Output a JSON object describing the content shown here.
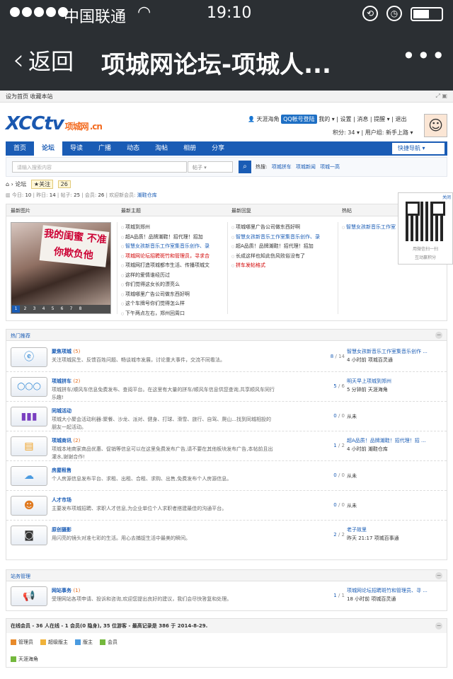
{
  "status": {
    "carrier": "中国联通",
    "time": "19:10"
  },
  "nav": {
    "back": "返回",
    "title": "项城网论坛-项城人...",
    "more": "•••"
  },
  "toplinks": {
    "home": "设为首页",
    "fav": "收藏本站"
  },
  "logo": {
    "main": "XCCtv",
    "sub": "项城网",
    "cn": ".cn"
  },
  "user": {
    "name": "天涯海角",
    "qq": "QQ帐号登陆",
    "links": "我的 ▾ | 设置 | 消息 | 提醒 ▾ | 退出",
    "score": "积分: 34 ▾",
    "group": "用户组: 新手上路 ▾"
  },
  "mainnav": {
    "items": [
      "首页",
      "论坛",
      "导读",
      "广播",
      "动态",
      "淘帖",
      "相册",
      "分享"
    ],
    "active": 1,
    "quick": "快捷导航 ▾"
  },
  "search": {
    "placeholder": "请输入搜索内容",
    "scope": "帖子 ▾",
    "hot_label": "热搜:",
    "hot": [
      "项城拼车",
      "项城新闻",
      "项城一高"
    ]
  },
  "crumb": {
    "text": "论坛",
    "fav": "关注",
    "fav_count": "26"
  },
  "stats": {
    "today_label": "今日:",
    "today": "10",
    "yday_label": "昨日:",
    "yday": "14",
    "posts_label": "帖子:",
    "posts": "25",
    "members_label": "会员:",
    "members": "26",
    "welcome": "欢迎新会员:",
    "newest": "潮鞋仓库"
  },
  "qr": {
    "close": "关闭",
    "line1": "用微信扫一扫",
    "line2": "互动赢积分"
  },
  "panel": {
    "head": [
      "最新图片",
      "最新主题",
      "最新回复",
      "热帖"
    ],
    "image_caption": "我的闺蜜 不准你欺负他",
    "pages": [
      "1",
      "2",
      "3",
      "4",
      "5",
      "6",
      "7",
      "8"
    ],
    "topics": [
      "项城到郑州",
      "超A品质！品牌潮鞋！招代理！招加",
      "智慧女孩新音乐工作室集音乐创作、录",
      "项城网论坛招聘斑竹和管理员，寻求合",
      "项城网打造项城都市生活、传播项城文",
      "这样的爱情谁经历过",
      "你们觉得这女长的漂亮么",
      "项城哪里广告公司做东西好啊",
      "这个车牌号你们觉得怎么样",
      "下午两点左右，郑州回周口"
    ],
    "replies": [
      "项城哪里广告公司做东西好啊",
      "智慧女孩新音乐工作室集音乐创作、录",
      "超A品质！品牌潮鞋！招代理！招加",
      "长成这样也知此伤风败俗没有了",
      "拼车发帖格式"
    ],
    "hot": [
      "智慧女孩新音乐工作室"
    ]
  },
  "section_hot": {
    "title": "热门推荐",
    "toggle": "−"
  },
  "section_admin": {
    "title": "站务管理",
    "toggle": "−"
  },
  "forums": [
    {
      "icon": "ie-logo-icon",
      "name": "聚焦项城",
      "count": "(5)",
      "desc": "关注项城民生、反馈百姓问题、畅谈城市发展，讨论重大事件，交流不同看法。",
      "threads": "8",
      "posts": "14",
      "last_title": "智慧女孩新音乐工作室集音乐创作 ...",
      "last_meta": "4 小时前 项城百灵通"
    },
    {
      "icon": "olympic-rings-icon",
      "name": "项城拼车",
      "count": "(2)",
      "desc": "项城拼车/顺风车信息免费发布、查阅平台。在这里有大量的拼车/顺风车信息供您查询,共享顺风车同行乐趣!",
      "threads": "5",
      "posts": "6",
      "last_title": "明天早上项城到郑州",
      "last_meta": "5 分钟前 天涯海角"
    },
    {
      "icon": "activity-icon",
      "name": "同城活动",
      "count": "",
      "desc": "项城大小聚会活动利器:聚餐、沙龙、派对、健身、打球、滑雪、旅行、自驾、爬山...找到同城相投的朋友一起活动。",
      "threads": "0",
      "posts": "0",
      "last_none": "从未"
    },
    {
      "icon": "chat-bubbles-icon",
      "name": "项城商讯",
      "count": "(2)",
      "desc": "项城本地商家商品优惠、促销等信息可以在这里免费发布广告,请不要在其他板块发布广告,本帖前且出灌水,谢谢合作!",
      "threads": "1",
      "posts": "2",
      "last_title": "超A品质！品牌潮鞋！招代理！招 ...",
      "last_meta": "4 小时前 潮鞋仓库"
    },
    {
      "icon": "cloud-icon",
      "name": "房屋租售",
      "count": "",
      "desc": "个人房源信息发布平台、求租、出租、合租、求购、出售,免费发布个人房源信息。",
      "threads": "0",
      "posts": "0",
      "last_none": "从未"
    },
    {
      "icon": "person-icon",
      "name": "人才市场",
      "count": "",
      "desc": "主要发布项城招聘、求职人才信息,为企业单位个人求职者搭建最佳的沟通平台。",
      "threads": "0",
      "posts": "0",
      "last_none": "从未"
    },
    {
      "icon": "camera-icon",
      "name": "原创摄影",
      "count": "",
      "desc": "用闪亮的镜头对准七彩的生活。用心去捕捉生活中最美的瞬间。",
      "threads": "2",
      "posts": "2",
      "last_title": "老子故里",
      "last_meta": "昨天 21:17 项城百事通"
    }
  ],
  "admin_forum": {
    "icon": "megaphone-icon",
    "name": "网站事务",
    "count": "(1)",
    "desc": "受理网站各项申请、投诉和咨询,欢迎您提出良好的建议，我们会尽快答复和处理。",
    "threads": "1",
    "posts": "1",
    "last_title": "项城网论坛招聘斑竹和管理员、寻 ...",
    "last_meta": "18 小时前 项城百灵通"
  },
  "online": {
    "text": "在线会员 - 36 人在线 - 1 会员(0 隐身), 35 位游客 - 最高记录是 386 于 2014-8-29.",
    "legend": [
      "管理员",
      "超级版主",
      "版主",
      "会员"
    ],
    "user": "天涯海角",
    "toggle": "−"
  }
}
